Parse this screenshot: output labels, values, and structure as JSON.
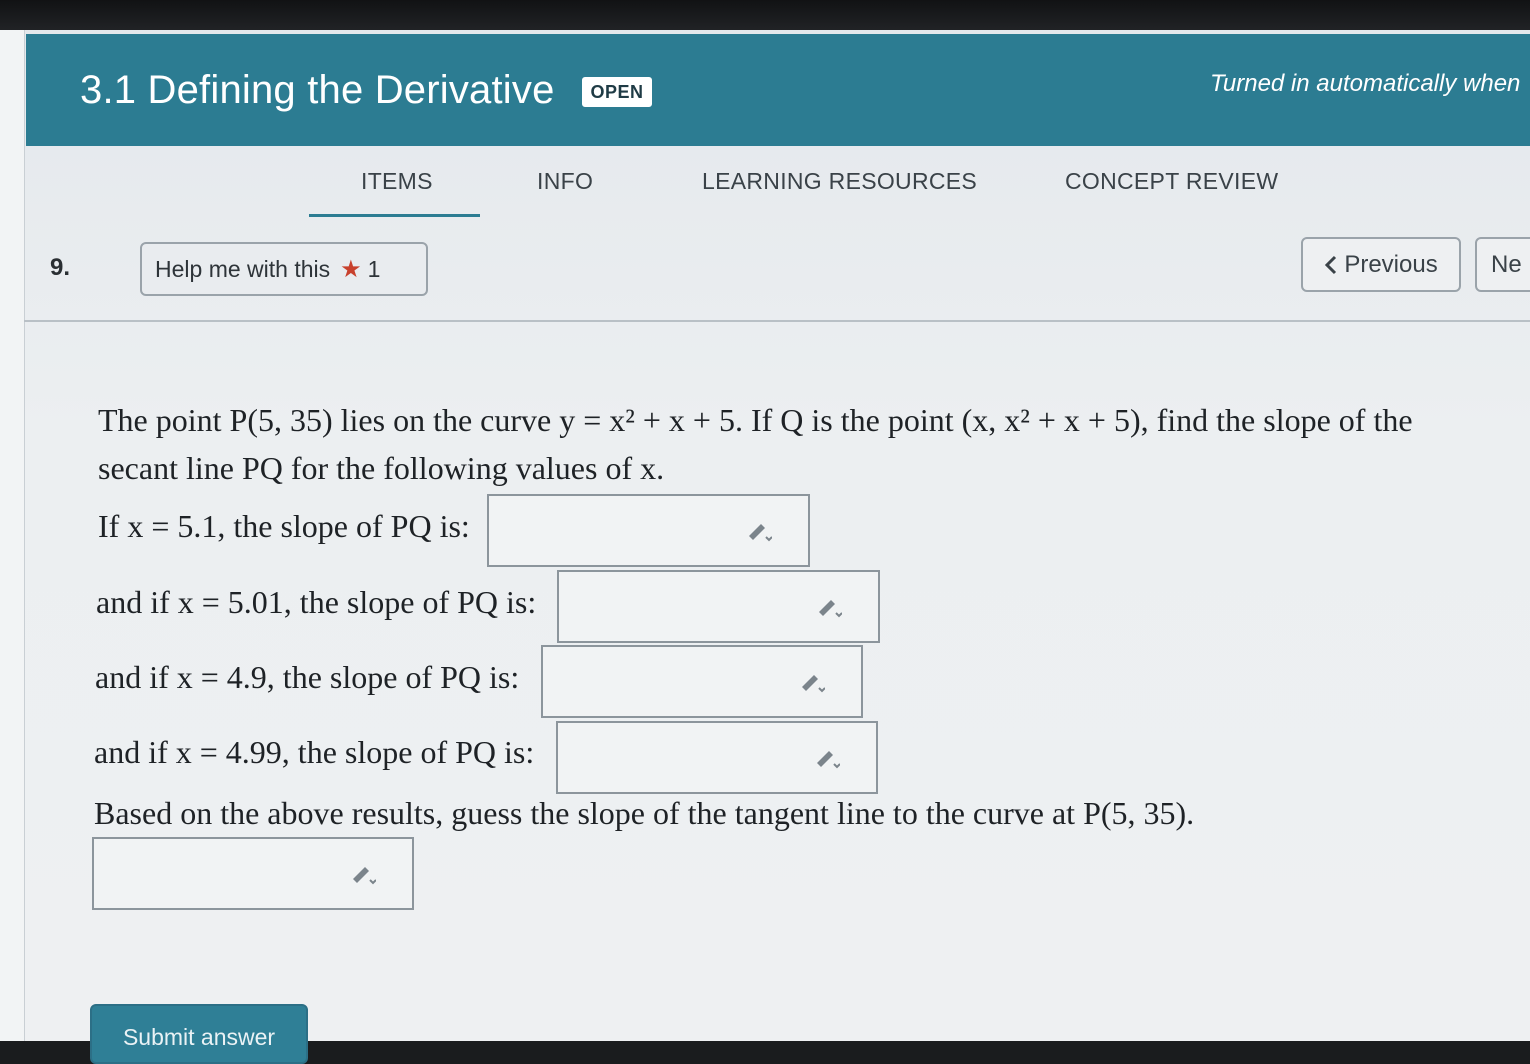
{
  "assignment": {
    "title": "3.1 Defining the Derivative",
    "status_badge": "OPEN",
    "auto_submit_note": "Turned in automatically when"
  },
  "tabs": [
    {
      "label": "ITEMS",
      "active": true
    },
    {
      "label": "INFO",
      "active": false
    },
    {
      "label": "LEARNING RESOURCES",
      "active": false
    },
    {
      "label": "CONCEPT REVIEW",
      "active": false
    }
  ],
  "question": {
    "number": "9.",
    "help_label": "Help me with this",
    "help_count": "1",
    "prev_label": "Previous",
    "next_label": "Ne",
    "prompt_line1": "The point P(5, 35) lies on the curve y = x² + x + 5. If Q is the point (x, x² + x + 5), find the slope of the",
    "prompt_line2": "secant line PQ for the following values of x.",
    "parts": [
      {
        "label": "If x = 5.1, the slope of PQ is:",
        "value": ""
      },
      {
        "label": "and if x = 5.01, the slope of PQ is:",
        "value": ""
      },
      {
        "label": "and if x = 4.9, the slope of PQ is:",
        "value": ""
      },
      {
        "label": "and if x = 4.99, the slope of PQ is:",
        "value": ""
      }
    ],
    "tangent_prompt": "Based on the above results, guess the slope of the tangent line to the curve at P(5, 35).",
    "tangent_value": "",
    "submit_label": "Submit answer"
  },
  "colors": {
    "header_bg": "#2c7c92",
    "accent": "#2c7c92",
    "help_star": "#c8412d"
  },
  "icons": [
    "star-icon",
    "chevron-left-icon",
    "pencil-icon"
  ]
}
